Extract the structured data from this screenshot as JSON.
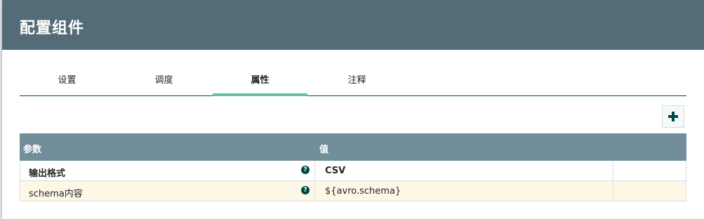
{
  "dialog": {
    "title": "配置组件"
  },
  "tabs": [
    {
      "label": "设置",
      "active": false
    },
    {
      "label": "调度",
      "active": false
    },
    {
      "label": "属性",
      "active": true
    },
    {
      "label": "注释",
      "active": false
    }
  ],
  "toolbar": {
    "add_icon": "plus-icon"
  },
  "table": {
    "headers": {
      "param": "参数",
      "value": "值"
    },
    "rows": [
      {
        "name": "输出格式",
        "value": "CSV",
        "bold": true
      },
      {
        "name": "schema内容",
        "value": "${avro.schema}",
        "bold": false
      }
    ]
  },
  "colors": {
    "header_bg": "#546b78",
    "table_header_bg": "#728e9b",
    "active_tab_underline": "#60c39b",
    "accent_dark": "#004849",
    "alt_row_bg": "#fdf8e6"
  }
}
